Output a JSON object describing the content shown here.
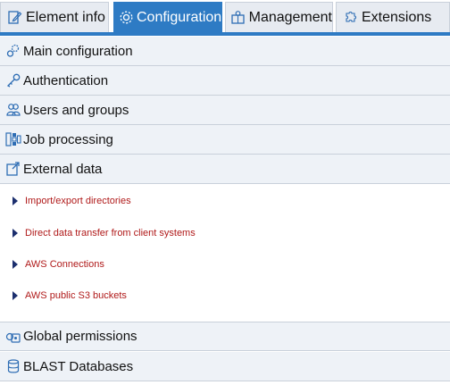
{
  "tabs": [
    {
      "label": "Element info",
      "icon": "edit-document-icon",
      "active": false
    },
    {
      "label": "Configuration",
      "icon": "gear-icon",
      "active": true
    },
    {
      "label": "Management",
      "icon": "management-icon",
      "active": false
    },
    {
      "label": "Extensions",
      "icon": "puzzle-icon",
      "active": false
    }
  ],
  "sections": [
    {
      "label": "Main configuration",
      "icon": "gears-icon"
    },
    {
      "label": "Authentication",
      "icon": "key-icon"
    },
    {
      "label": "Users and groups",
      "icon": "users-icon"
    },
    {
      "label": "Job processing",
      "icon": "job-processing-icon"
    },
    {
      "label": "External data",
      "icon": "external-data-icon",
      "expanded": true
    },
    {
      "label": "Global permissions",
      "icon": "global-permissions-icon"
    },
    {
      "label": "BLAST Databases",
      "icon": "database-icon"
    }
  ],
  "external_data_items": [
    {
      "label": "Import/export directories"
    },
    {
      "label": "Direct data transfer from client systems"
    },
    {
      "label": "AWS Connections"
    },
    {
      "label": "AWS public S3 buckets"
    }
  ],
  "colors": {
    "accent": "#2e7bc4",
    "link": "#b01a1a",
    "section_bg": "#eef2f7"
  }
}
